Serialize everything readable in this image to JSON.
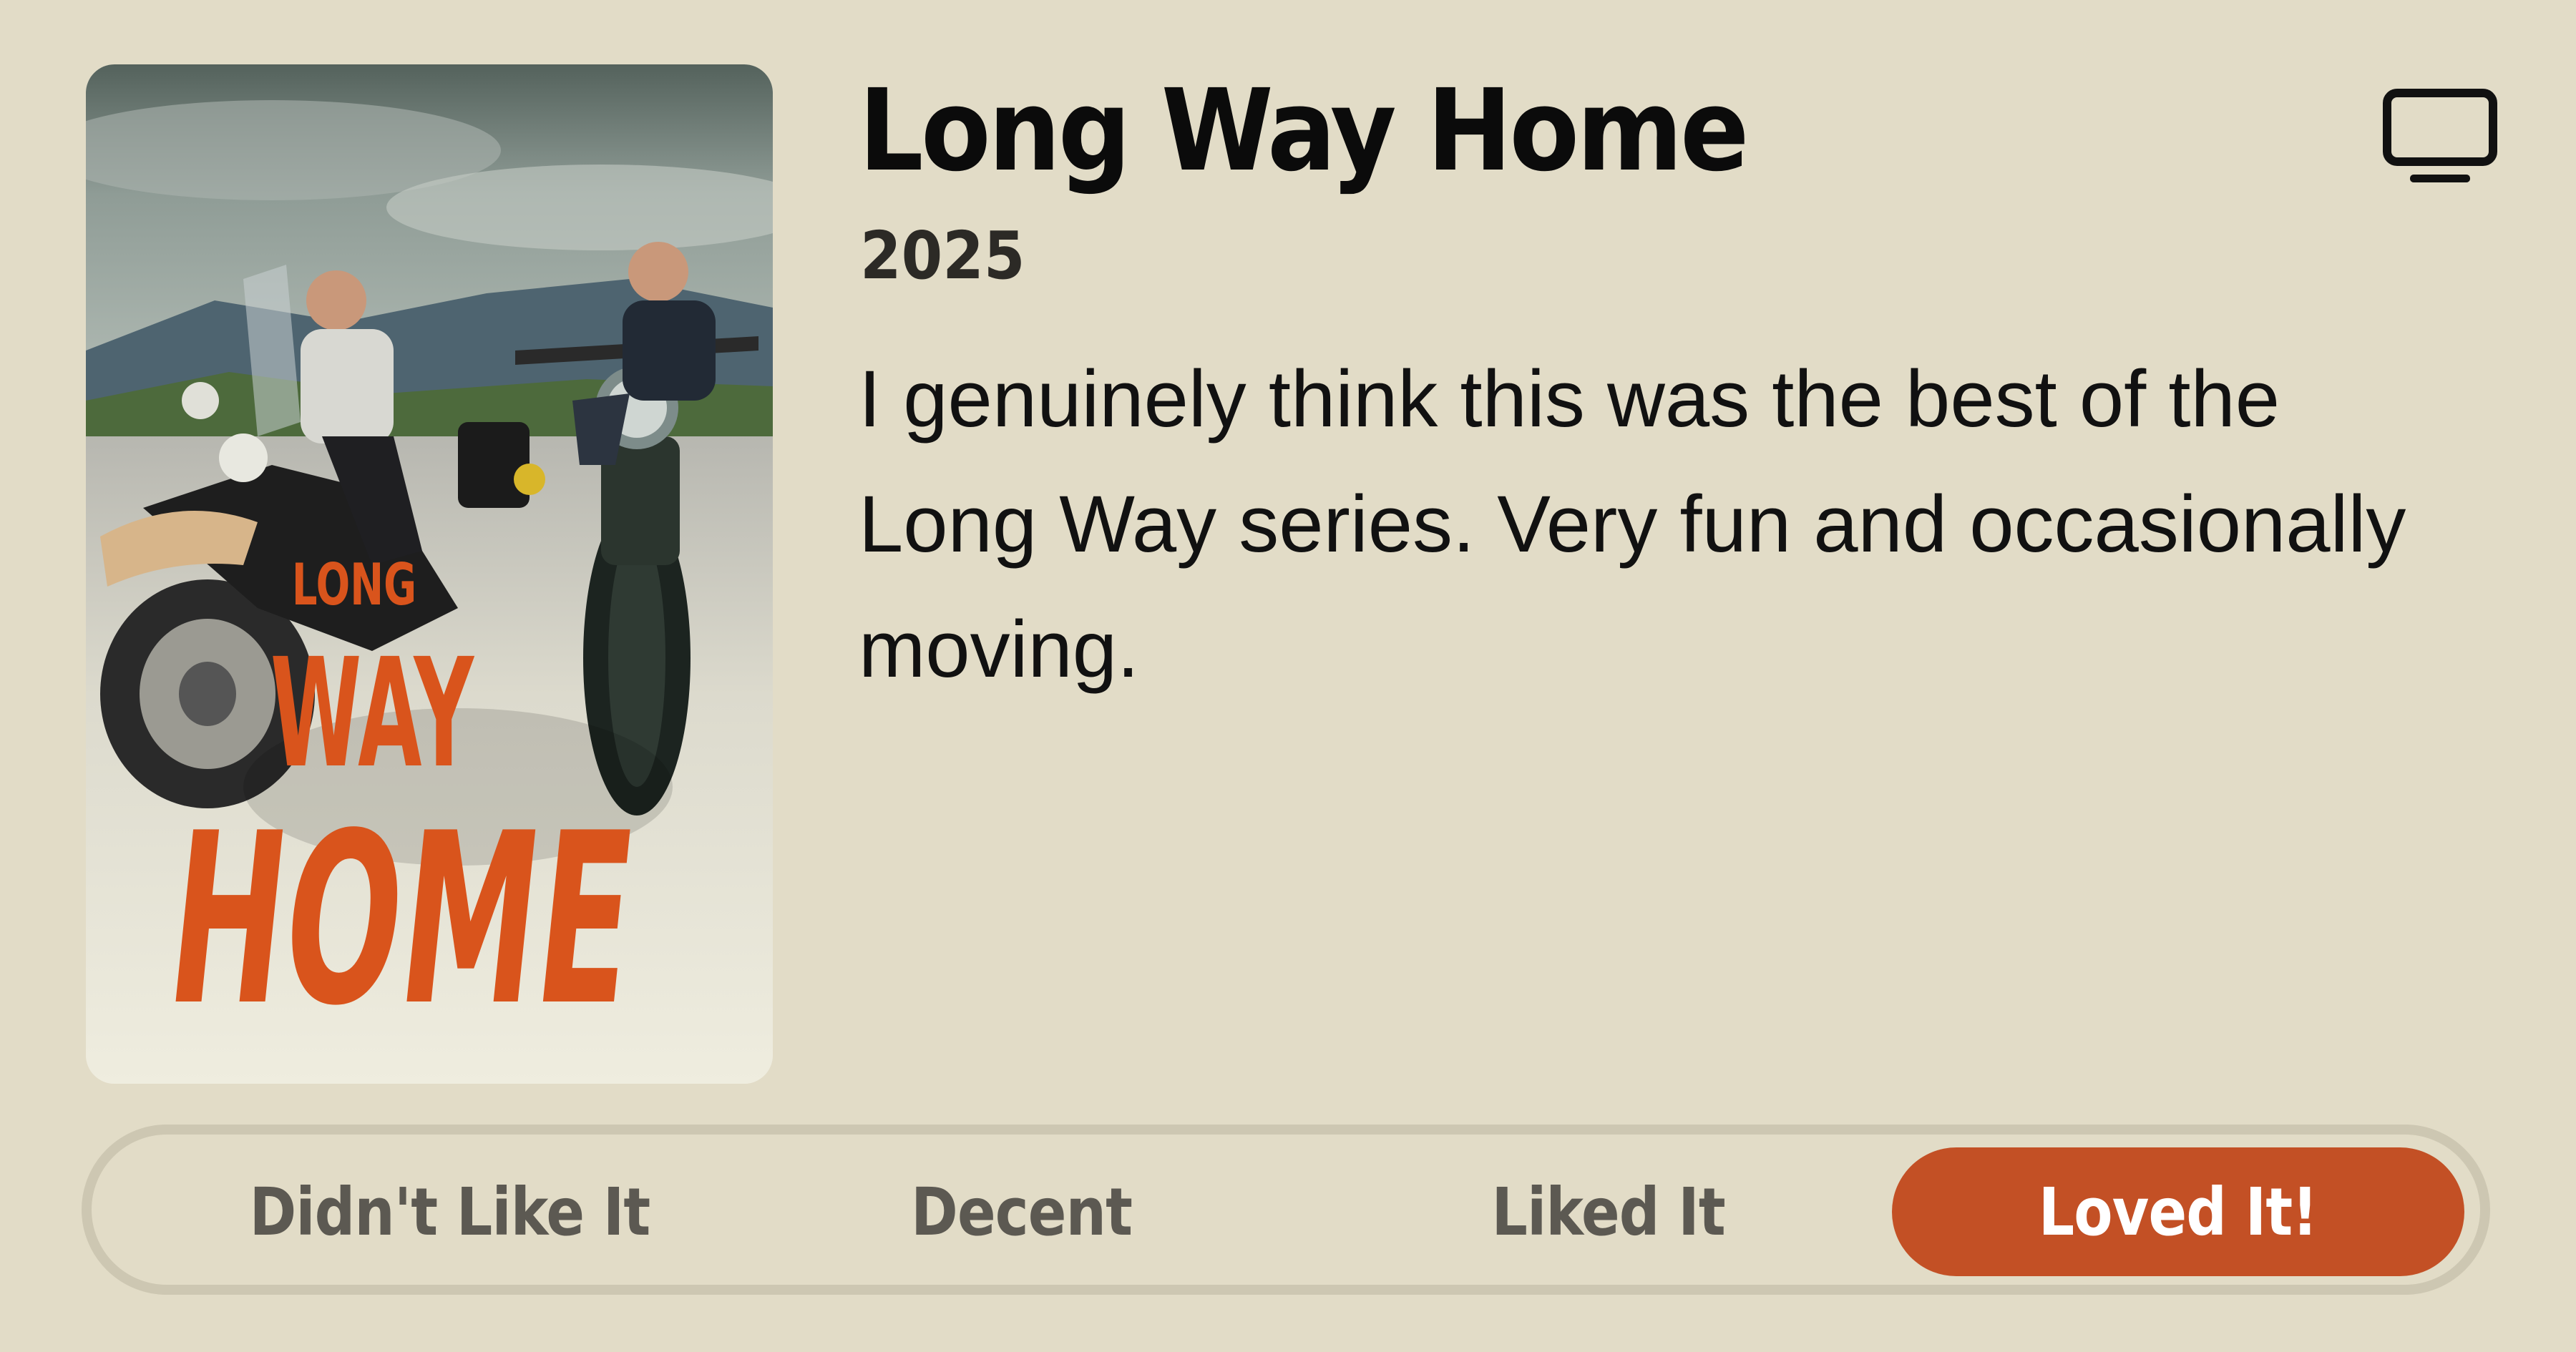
{
  "title": "Long Way Home",
  "year": "2025",
  "review": "I genuinely think this was the best of the Long Way series. Very fun and occasionally moving.",
  "media_type_icon": "tv-icon",
  "poster": {
    "title_lines": [
      "LONG",
      "WAY",
      "HOME"
    ]
  },
  "rating": {
    "options": [
      {
        "label": "Didn't Like It"
      },
      {
        "label": "Decent"
      },
      {
        "label": "Liked It"
      },
      {
        "label": "Loved It!"
      }
    ],
    "selected": "Loved It!"
  },
  "colors": {
    "background": "#e2dcc7",
    "accent": "#c35025",
    "poster_title": "#d9541c"
  }
}
